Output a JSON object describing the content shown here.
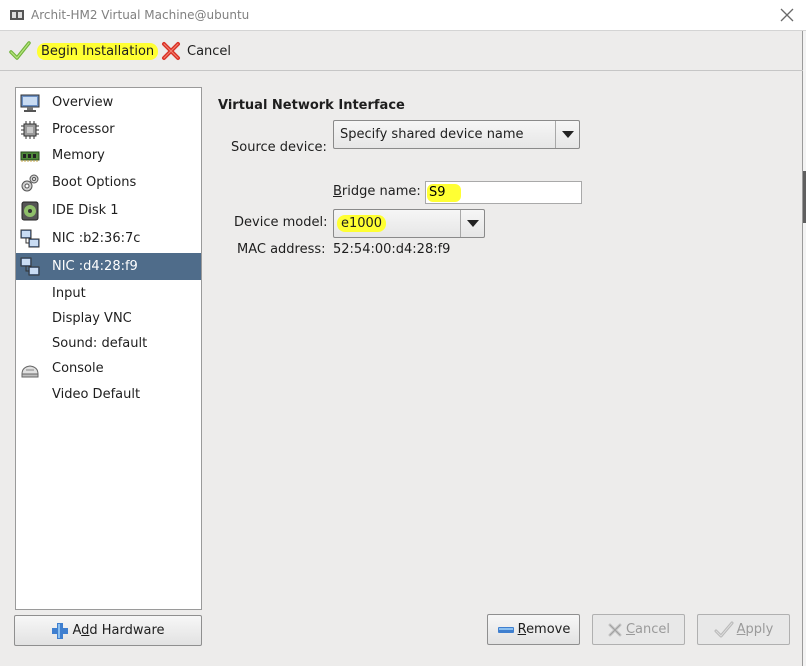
{
  "window": {
    "title": "Archit-HM2 Virtual Machine@ubuntu"
  },
  "toolbar": {
    "begin_label": "Begin Installation",
    "cancel_label": "Cancel"
  },
  "sidebar": {
    "items": [
      {
        "label": "Overview",
        "icon": "monitor-icon"
      },
      {
        "label": "Processor",
        "icon": "cpu-chip-icon"
      },
      {
        "label": "Memory",
        "icon": "memory-stick-icon"
      },
      {
        "label": "Boot Options",
        "icon": "gears-icon"
      },
      {
        "label": "IDE Disk 1",
        "icon": "disk-icon"
      },
      {
        "label": "NIC :b2:36:7c",
        "icon": "network-icon"
      },
      {
        "label": "NIC :d4:28:f9",
        "icon": "network-icon"
      },
      {
        "label": "Input",
        "icon": ""
      },
      {
        "label": "Display VNC",
        "icon": ""
      },
      {
        "label": "Sound: default",
        "icon": ""
      },
      {
        "label": "Console",
        "icon": "console-icon"
      },
      {
        "label": "Video Default",
        "icon": ""
      }
    ],
    "selected_index": 6,
    "add_hardware_label": "Add Hardware",
    "add_hardware_mnemonic": "d"
  },
  "details": {
    "section_title": "Virtual Network Interface",
    "source_device_label": "Source device:",
    "source_device_value": "Specify shared device name",
    "bridge_label": "Bridge name:",
    "bridge_label_mnemonic": "B",
    "bridge_value": "S9",
    "device_model_label": "Device model:",
    "device_model_value": "e1000",
    "mac_label": "MAC address:",
    "mac_value": "52:54:00:d4:28:f9"
  },
  "actions": {
    "remove_label": "Remove",
    "cancel_label": "Cancel",
    "apply_label": "Apply"
  },
  "colors": {
    "selection": "#4f6c8a",
    "highlight": "#ffff33",
    "window_bg": "#edeceb"
  }
}
